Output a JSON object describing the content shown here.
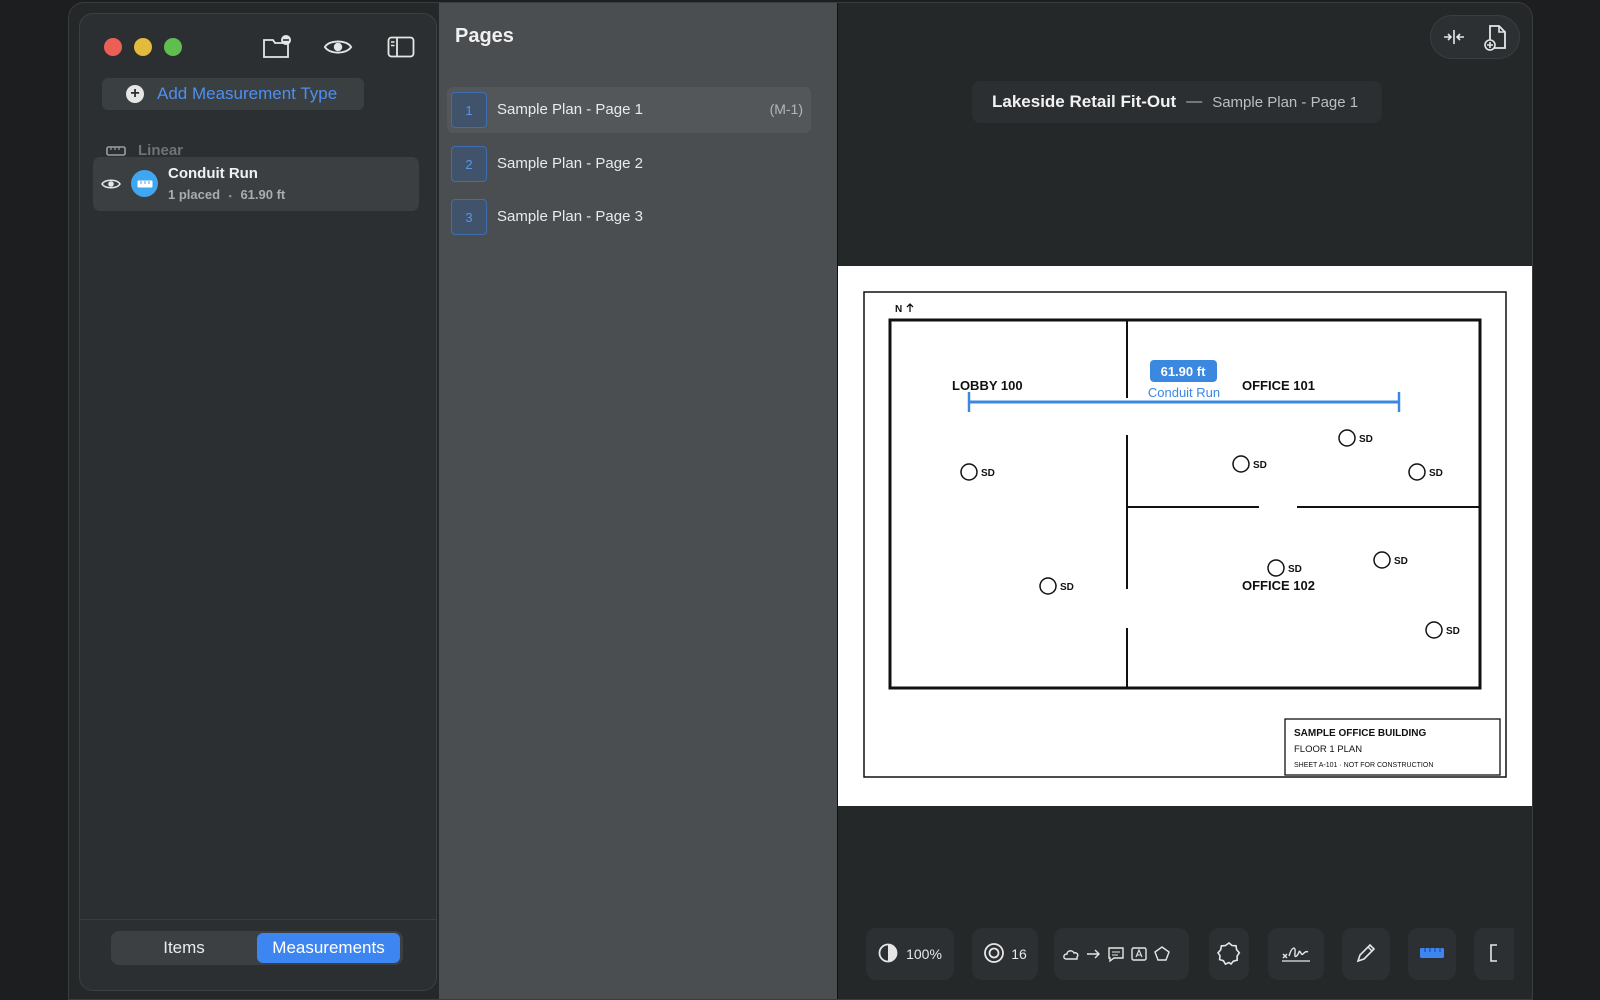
{
  "sidebar": {
    "add_measurement_type": "Add Measurement Type",
    "section_label": "Linear",
    "measurement_types": [
      {
        "name": "Conduit Run",
        "placed": "1 placed",
        "separator": "•",
        "length": "61.90 ft",
        "color": "#3fa6f0"
      }
    ],
    "segment": {
      "items": "Items",
      "measurements": "Measurements",
      "selected": "Measurements"
    }
  },
  "pages": {
    "title": "Pages",
    "list": [
      {
        "num": "1",
        "name": "Sample Plan - Page 1",
        "tag": "(M-1)"
      },
      {
        "num": "2",
        "name": "Sample Plan - Page 2",
        "tag": ""
      },
      {
        "num": "3",
        "name": "Sample Plan - Page 3",
        "tag": ""
      }
    ]
  },
  "viewer": {
    "project": "Lakeside Retail Fit-Out",
    "dash": "—",
    "page": "Sample Plan - Page 1",
    "plan": {
      "north": "N",
      "rooms": [
        "LOBBY 100",
        "OFFICE 101",
        "OFFICE 102"
      ],
      "detector_label": "SD",
      "measure_value": "61.90 ft",
      "measure_name": "Conduit Run",
      "title_block": {
        "line1": "SAMPLE OFFICE BUILDING",
        "line2": "FLOOR 1 PLAN",
        "line3": "SHEET A-101  ·  NOT FOR CONSTRUCTION"
      }
    },
    "toolbar": {
      "opacity": "100%",
      "count": "16"
    }
  },
  "colors": {
    "accent": "#3d85f0",
    "measure": "#3b88e0"
  }
}
